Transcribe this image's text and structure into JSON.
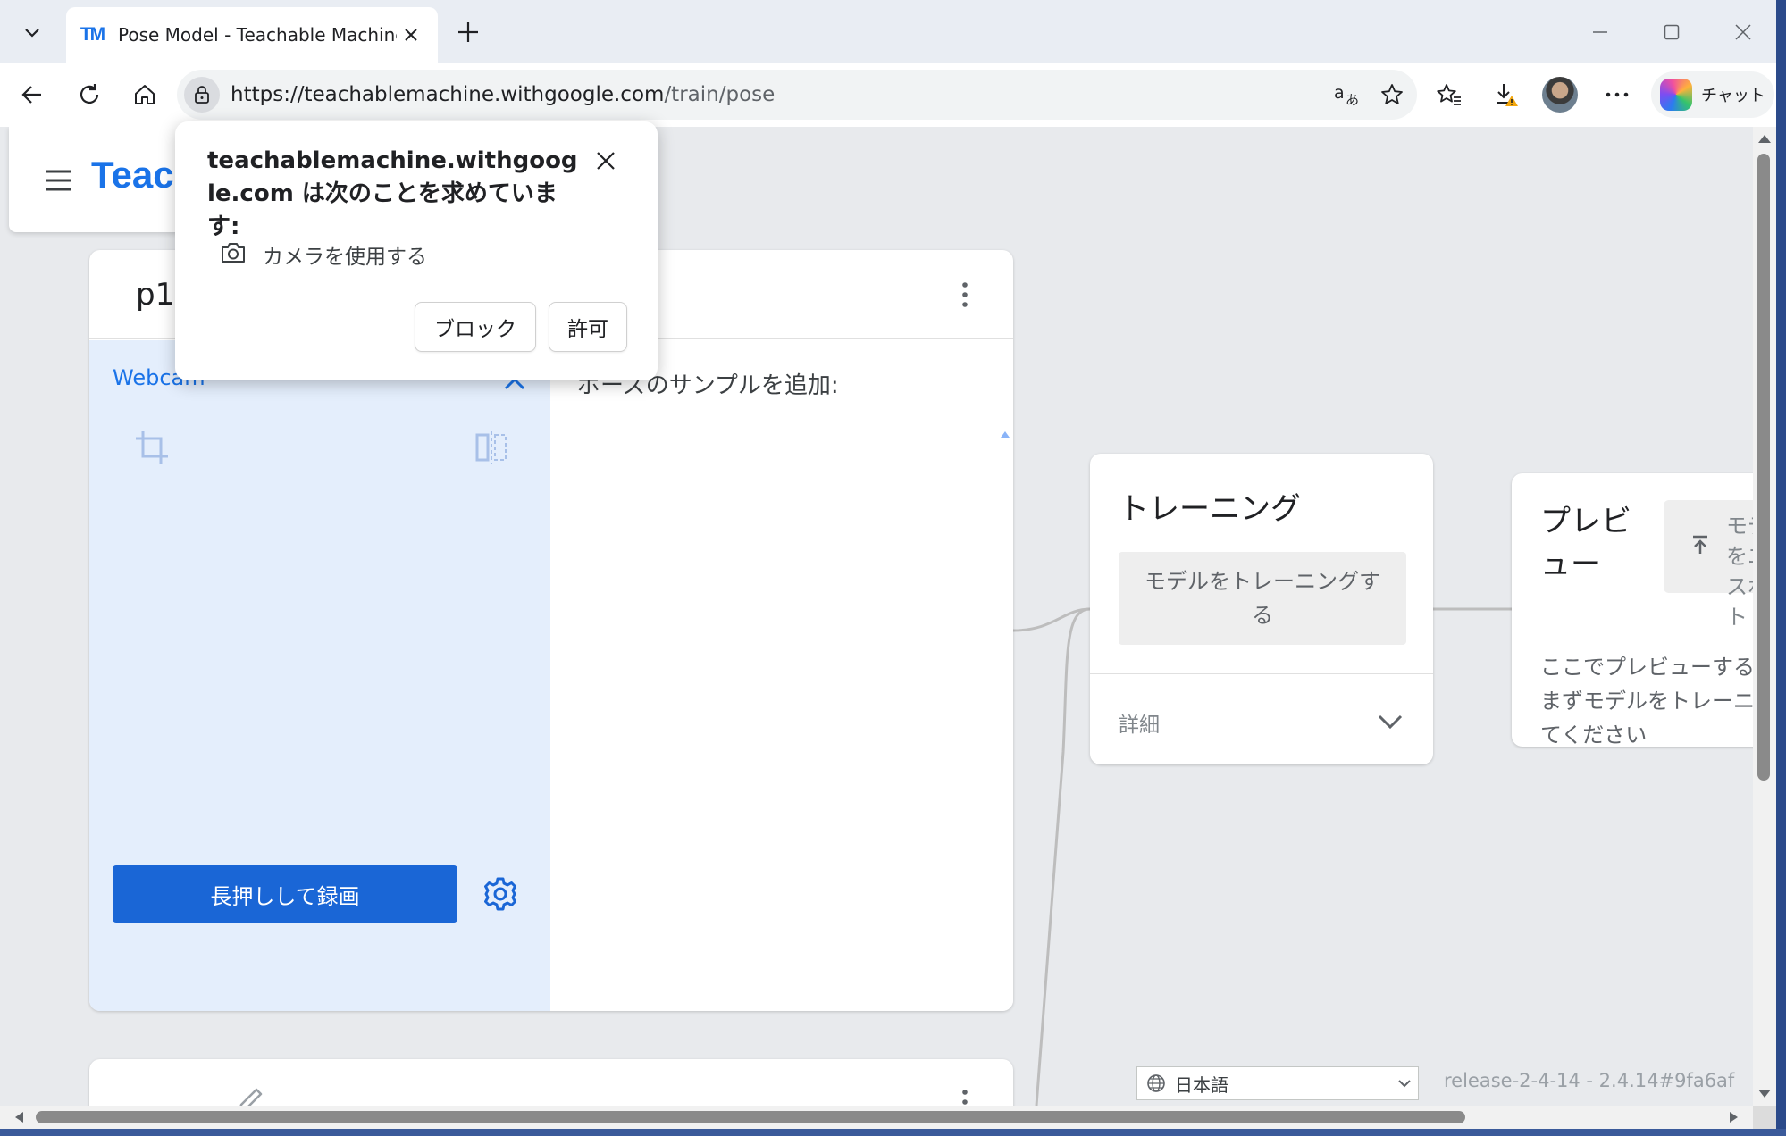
{
  "browser": {
    "tab_title": "Pose Model - Teachable Machines",
    "tab_favicon": "TM",
    "url_host": "https://teachablemachine.withgoogle.com",
    "url_path": "/train/pose",
    "copilot_label": "チャット",
    "icons": [
      "tab-list-icon",
      "close-icon",
      "new-tab-icon",
      "minimize-icon",
      "maximize-icon",
      "window-close-icon",
      "back-icon",
      "reload-icon",
      "home-icon",
      "lock-icon",
      "read-aloud-icon",
      "favorite-star-icon",
      "favorites-icon",
      "downloads-warning-icon",
      "more-icon",
      "copilot-icon"
    ]
  },
  "app": {
    "logo_text": "Teachable Machine"
  },
  "class_card": {
    "class_name": "p1",
    "webcam_label": "Webcam",
    "record_button": "長押しして録画",
    "samples_title": "ポーズのサンプルを追加:"
  },
  "training": {
    "title": "トレーニング",
    "train_button": "モデルをトレーニングする",
    "advanced_label": "詳細"
  },
  "preview": {
    "title": "プレビュー",
    "export_button": "モデルをエクスポート",
    "description": "ここでプレビューするには、まずモデルをトレーニングしてください"
  },
  "footer": {
    "language": "日本語",
    "version": "release-2-4-14 - 2.4.14#9fa6af"
  },
  "permission_popup": {
    "title": "teachablemachine.withgoogle.com は次のことを求めています:",
    "request": "カメラを使用する",
    "block_button": "ブロック",
    "allow_button": "許可"
  },
  "colors": {
    "accent": "#1a73e8",
    "record_button": "#1a66d6",
    "webcam_panel": "#e4eefc",
    "canvas_bg": "#e8eaed"
  }
}
